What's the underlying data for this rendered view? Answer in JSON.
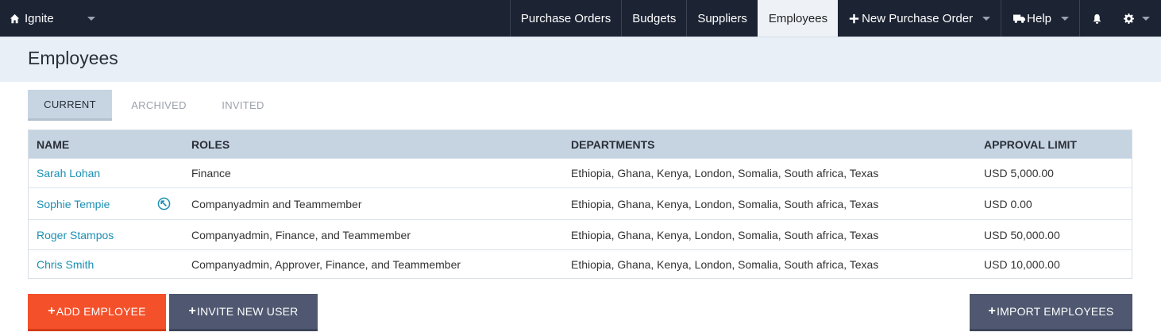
{
  "nav": {
    "brand": "Ignite",
    "links": [
      "Purchase Orders",
      "Budgets",
      "Suppliers",
      "Employees"
    ],
    "new_po": "New Purchase Order",
    "help": "Help",
    "icons": {
      "home": "home-icon",
      "plus": "plus-icon",
      "help": "truck-icon",
      "bell": "bell-icon",
      "gear": "gear-icon"
    }
  },
  "page": {
    "title": "Employees"
  },
  "tabs": [
    "CURRENT",
    "ARCHIVED",
    "INVITED"
  ],
  "table": {
    "headers": [
      "NAME",
      "ROLES",
      "DEPARTMENTS",
      "APPROVAL LIMIT"
    ],
    "rows": [
      {
        "name": "Sarah Lohan",
        "roles": "Finance",
        "departments": "Ethiopia, Ghana, Kenya, London, Somalia, South africa, Texas",
        "limit": "USD 5,000.00"
      },
      {
        "name": "Sophie Tempie",
        "roles": "Companyadmin and Teammember",
        "departments": "Ethiopia, Ghana, Kenya, London, Somalia, South africa, Texas",
        "limit": "USD 0.00"
      },
      {
        "name": "Roger Stampos",
        "roles": "Companyadmin, Finance, and Teammember",
        "departments": "Ethiopia, Ghana, Kenya, London, Somalia, South africa, Texas",
        "limit": "USD 50,000.00"
      },
      {
        "name": "Chris Smith",
        "roles": "Companyadmin, Approver, Finance, and Teammember",
        "departments": "Ethiopia, Ghana, Kenya, London, Somalia, South africa, Texas",
        "limit": "USD 10,000.00"
      }
    ]
  },
  "buttons": {
    "add": "ADD EMPLOYEE",
    "invite": "INVITE NEW USER",
    "import": "IMPORT EMPLOYEES",
    "plus": "+"
  },
  "colors": {
    "topbar": "#1c2333",
    "accent": "#f4502a",
    "secondary": "#4f5870",
    "link": "#1b8fb3"
  }
}
